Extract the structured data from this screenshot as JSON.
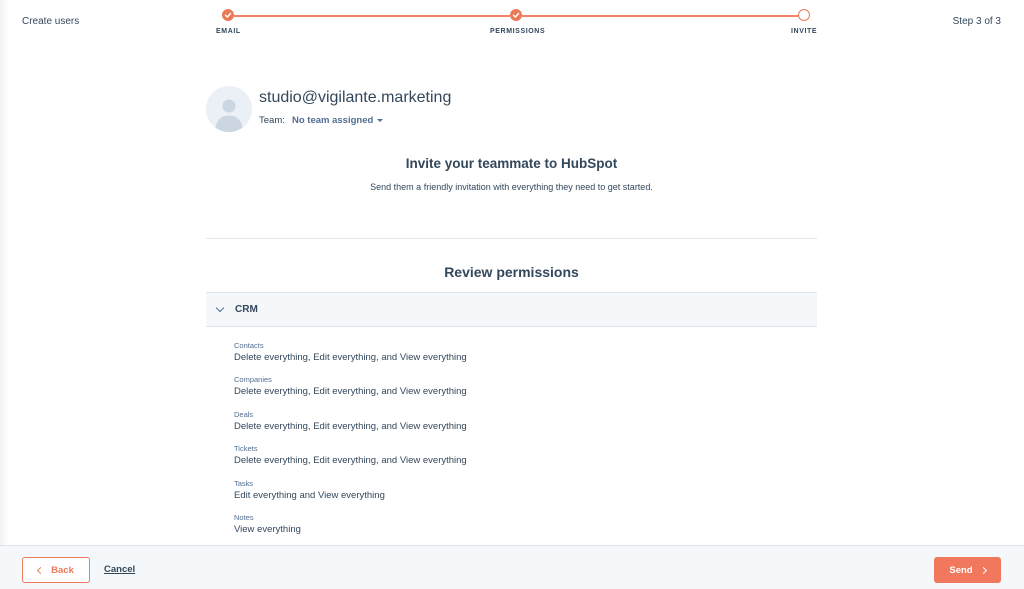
{
  "header": {
    "title": "Create users",
    "step_indicator": "Step 3 of 3"
  },
  "stepper": {
    "steps": [
      {
        "label": "EMAIL",
        "status": "done"
      },
      {
        "label": "PERMISSIONS",
        "status": "done"
      },
      {
        "label": "INVITE",
        "status": "current"
      }
    ]
  },
  "user": {
    "email": "studio@vigilante.marketing",
    "team_label": "Team:",
    "team_value": "No team assigned"
  },
  "invite": {
    "title": "Invite your teammate to HubSpot",
    "subtitle": "Send them a friendly invitation with everything they need to get started."
  },
  "review": {
    "title": "Review permissions",
    "section": "CRM",
    "items": [
      {
        "name": "Contacts",
        "value": "Delete everything, Edit everything, and View everything"
      },
      {
        "name": "Companies",
        "value": "Delete everything, Edit everything, and View everything"
      },
      {
        "name": "Deals",
        "value": "Delete everything, Edit everything, and View everything"
      },
      {
        "name": "Tickets",
        "value": "Delete everything, Edit everything, and View everything"
      },
      {
        "name": "Tasks",
        "value": "Edit everything and View everything"
      },
      {
        "name": "Notes",
        "value": "View everything"
      }
    ]
  },
  "footer": {
    "back_label": "Back",
    "cancel_label": "Cancel",
    "send_label": "Send"
  },
  "colors": {
    "accent": "#ea7a5a",
    "primary_button": "#f1785d",
    "text": "#33475b"
  },
  "icons": {
    "step_done": "check-icon",
    "section_toggle": "chevron-down-icon",
    "team_dropdown": "caret-down-icon",
    "back": "chevron-left-icon",
    "send": "chevron-right-icon",
    "avatar": "user-silhouette-icon"
  }
}
